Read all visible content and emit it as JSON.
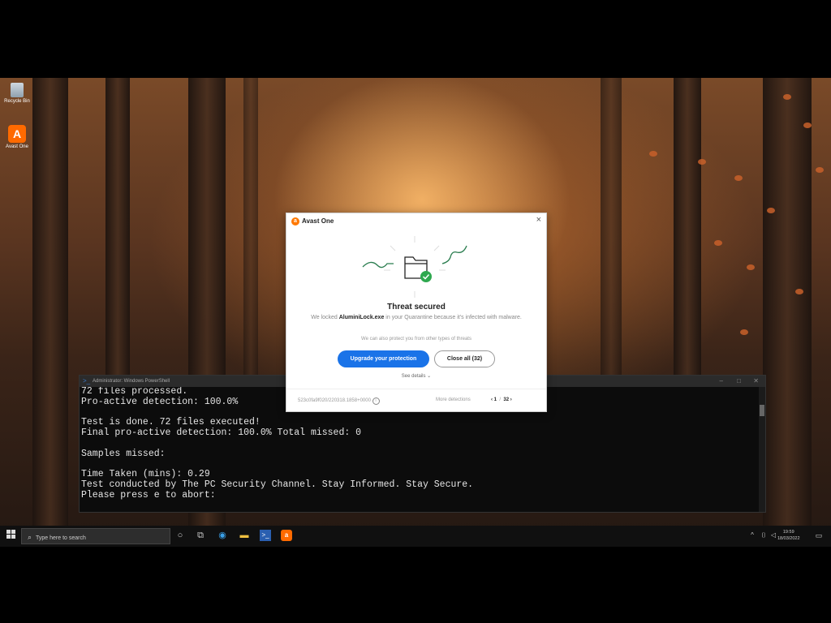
{
  "desktop": {
    "icons": [
      {
        "label": "Recycle Bin",
        "icon": "recycle-bin-icon"
      },
      {
        "label": "Avast One",
        "icon": "avast-one-icon"
      }
    ]
  },
  "powershell": {
    "title": "Administrator: Windows PowerShell",
    "lines": [
      "72 files processed.",
      "Pro-active detection: 100.0%",
      "",
      "Test is done. 72 files executed!",
      "Final pro-active detection: 100.0% Total missed: 0",
      "",
      "Samples missed:",
      "",
      "Time Taken (mins): 0.29",
      "Test conducted by The PC Security Channel. Stay Informed. Stay Secure.",
      "Please press e to abort:"
    ]
  },
  "dialog": {
    "app_name": "Avast One",
    "close_glyph": "×",
    "title": "Threat secured",
    "msg_pre": "We locked ",
    "msg_file": "AluminiLock.exe",
    "msg_post": " in your Quarantine because it's infected with malware.",
    "extra": "We can also protect you from other types of threats",
    "upgrade_label": "Upgrade your protection",
    "close_all_label": "Close all (32)",
    "see_details": "See details ⌄",
    "detection_id": "523c0fa9f020/220318.1858+0000",
    "more_detections": "More detections",
    "pager_prev": "‹ 1",
    "pager_sep": "/",
    "pager_next": "32 ›"
  },
  "taskbar": {
    "search_placeholder": "Type here to search",
    "time": "19:59",
    "date": "18/03/2022"
  }
}
